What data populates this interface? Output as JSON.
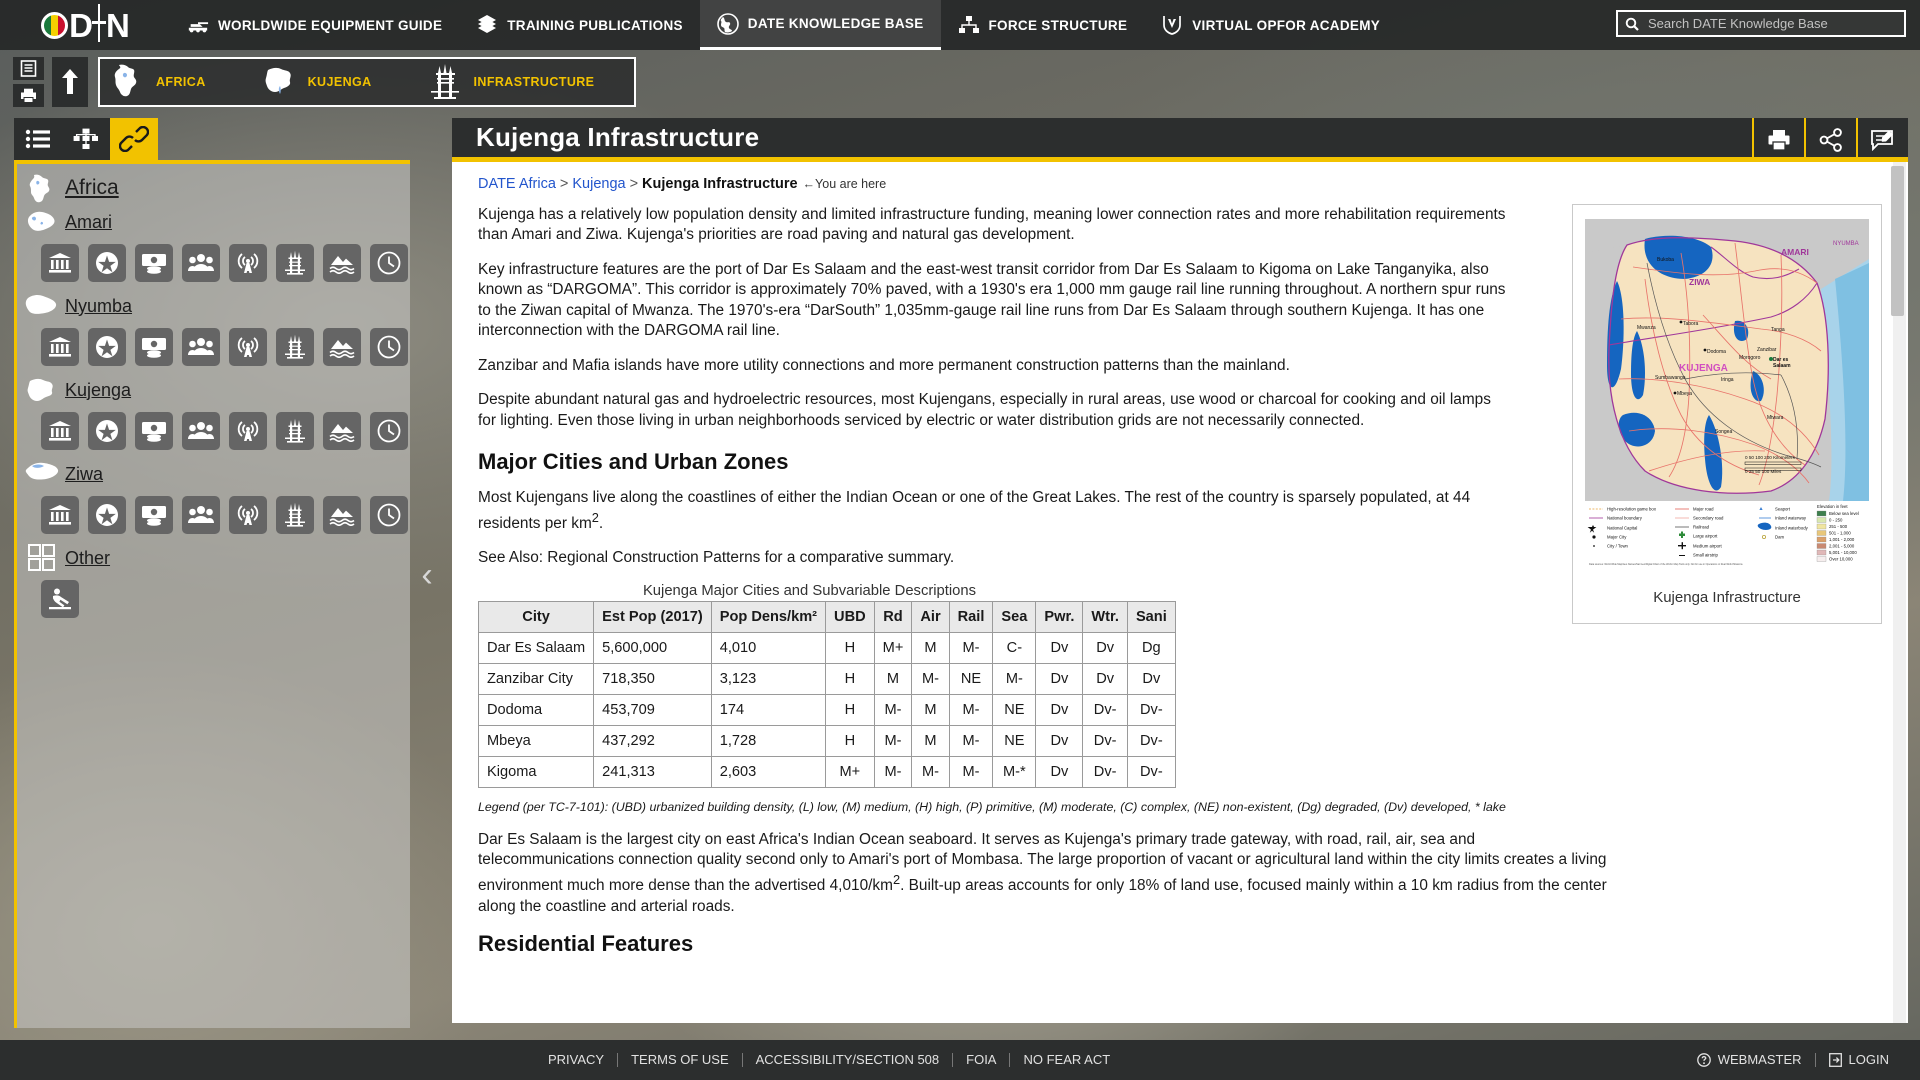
{
  "topnav": {
    "logo_text": "ODIN",
    "items": [
      {
        "label": "WORLDWIDE EQUIPMENT GUIDE",
        "icon": "tank-icon",
        "active": false
      },
      {
        "label": "TRAINING PUBLICATIONS",
        "icon": "books-icon",
        "active": false
      },
      {
        "label": "DATE KNOWLEDGE BASE",
        "icon": "globe-icon",
        "active": true
      },
      {
        "label": "FORCE STRUCTURE",
        "icon": "org-chart-icon",
        "active": false
      },
      {
        "label": "VIRTUAL OPFOR ACADEMY",
        "icon": "shield-v-icon",
        "active": false
      }
    ]
  },
  "search": {
    "placeholder": "Search DATE Knowledge Base",
    "value": ""
  },
  "crumbbar": {
    "doc_button": "document-icon",
    "print_button": "printer-icon",
    "up_button": "up-arrow-icon",
    "crumbs": [
      {
        "label": "AFRICA",
        "icon": "africa-map-icon"
      },
      {
        "label": "KUJENGA",
        "icon": "kujenga-map-icon"
      },
      {
        "label": "INFRASTRUCTURE",
        "icon": "infrastructure-icon"
      }
    ]
  },
  "leftpanel": {
    "tabs": [
      {
        "name": "list-view",
        "icon": "list-icon",
        "active": false
      },
      {
        "name": "tree-view",
        "icon": "org-tree-icon",
        "active": false
      },
      {
        "name": "links-view",
        "icon": "link-icon",
        "active": true
      }
    ],
    "variable_icons": [
      "political-icon",
      "military-icon",
      "economic-icon",
      "social-icon",
      "information-icon",
      "infrastructure-icon",
      "physical-environment-icon",
      "time-icon"
    ],
    "nodes": [
      {
        "label": "Africa",
        "icon": "africa-map-icon",
        "root": true,
        "has_variables": false
      },
      {
        "label": "Amari",
        "icon": "amari-map-icon",
        "root": false,
        "has_variables": true
      },
      {
        "label": "Nyumba",
        "icon": "nyumba-map-icon",
        "root": false,
        "has_variables": true
      },
      {
        "label": "Kujenga",
        "icon": "kujenga-map-icon",
        "root": false,
        "has_variables": true
      },
      {
        "label": "Ziwa",
        "icon": "ziwa-map-icon",
        "root": false,
        "has_variables": true
      },
      {
        "label": "Other",
        "icon": "grid-icon",
        "root": false,
        "has_variables": false
      }
    ],
    "other_icon": "threat-actor-icon",
    "collapse_arrow": "‹"
  },
  "main": {
    "title": "Kujenga Infrastructure",
    "actions": [
      {
        "name": "print-button",
        "icon": "printer-icon"
      },
      {
        "name": "share-button",
        "icon": "share-icon"
      },
      {
        "name": "feedback-button",
        "icon": "feedback-icon"
      }
    ],
    "breadcrumb": {
      "link1": "DATE Africa",
      "link2": "Kujenga",
      "current": "Kujenga Infrastructure",
      "you_are_here": "←You are here",
      "separator": ">"
    },
    "paragraphs": [
      "Kujenga has a relatively low population density and limited infrastructure funding, meaning lower connection rates and more rehabilitation requirements than Amari and Ziwa. Kujenga's priorities are road paving and natural gas development.",
      "Key infrastructure features are the port of Dar Es Salaam and the east-west transit corridor from Dar Es Salaam to Kigoma on Lake Tanganyika, also known as “DARGOMA”. This corridor is approximately 70% paved, with a 1930's era 1,000 mm gauge rail line running throughout. A northern spur runs to the Ziwan capital of Mwanza. The 1970's-era “DarSouth” 1,035mm-gauge rail line runs from Dar Es Salaam through southern Kujenga. It has one interconnection with the DARGOMA rail line.",
      "Zanzibar and Mafia islands have more utility connections and more permanent construction patterns than the mainland.",
      "Despite abundant natural gas and hydroelectric resources, most Kujengans, especially in rural areas, use wood or charcoal for cooking and oil lamps for lighting. Even those living in urban neighborhoods serviced by electric or water distribution grids are not necessarily connected."
    ],
    "section_heading": "Major Cities and Urban Zones",
    "para_density_pre": "Most Kujengans live along the coastlines of either the Indian Ocean or one of the Great Lakes. The rest of the country is sparsely populated, at 44 residents per km",
    "para_density_sup": "2",
    "para_density_post": ".",
    "see_also": "See Also: Regional Construction Patterns for a comparative summary.",
    "table_caption": "Kujenga Major Cities and Subvariable Descriptions",
    "legend_note": "Legend (per TC-7-101): (UBD) urbanized building density, (L) low, (M) medium, (H) high, (P) primitive, (M) moderate, (C) complex, (NE) non-existent, (Dg) degraded, (Dv) developed,  * lake",
    "final_para_pre": "Dar Es Salaam is the largest city on east Africa's Indian Ocean seaboard. It serves as Kujenga's primary trade gateway, with road, rail, air, sea and telecommunications connection quality second only to Amari's port of Mombasa. The large proportion of vacant or agricultural land within the city limits creates a living environment much more dense than the advertised 4,010/km",
    "final_para_sup": "2",
    "final_para_post": ". Built-up areas accounts for only 18% of land use, focused mainly within a 10 km radius from the center along the coastline and arterial roads.",
    "next_heading_partial": "Residential Features",
    "map_caption": "Kujenga Infrastructure"
  },
  "chart_data": {
    "type": "table",
    "title": "Kujenga Major Cities and Subvariable Descriptions",
    "columns": [
      "City",
      "Est Pop (2017)",
      "Pop Dens/km²",
      "UBD",
      "Rd",
      "Air",
      "Rail",
      "Sea",
      "Pwr.",
      "Wtr.",
      "Sani"
    ],
    "column_headers_plain": [
      "City",
      "Est Pop (2017)",
      "Pop Dens/km2",
      "UBD",
      "Rd",
      "Air",
      "Rail",
      "Sea",
      "Pwr.",
      "Wtr.",
      "Sani"
    ],
    "rows": [
      {
        "city": "Dar Es Salaam",
        "pop": "5,600,000",
        "dens": "4,010",
        "ubd": "H",
        "rd": "M+",
        "air": "M",
        "rail": "M-",
        "sea": "C-",
        "pwr": "Dv",
        "wtr": "Dv",
        "sani": "Dg"
      },
      {
        "city": "Zanzibar City",
        "pop": "718,350",
        "dens": "3,123",
        "ubd": "H",
        "rd": "M",
        "air": "M-",
        "rail": "NE",
        "sea": "M-",
        "pwr": "Dv",
        "wtr": "Dv",
        "sani": "Dv"
      },
      {
        "city": "Dodoma",
        "pop": "453,709",
        "dens": "174",
        "ubd": "H",
        "rd": "M-",
        "air": "M",
        "rail": "M-",
        "sea": "NE",
        "pwr": "Dv",
        "wtr": "Dv-",
        "sani": "Dv-"
      },
      {
        "city": "Mbeya",
        "pop": "437,292",
        "dens": "1,728",
        "ubd": "H",
        "rd": "M-",
        "air": "M",
        "rail": "M-",
        "sea": "NE",
        "pwr": "Dv",
        "wtr": "Dv-",
        "sani": "Dv-"
      },
      {
        "city": "Kigoma",
        "pop": "241,313",
        "dens": "2,603",
        "ubd": "M+",
        "rd": "M-",
        "air": "M-",
        "rail": "M-",
        "sea": "M-*",
        "pwr": "Dv",
        "wtr": "Dv-",
        "sani": "Dv-"
      }
    ]
  },
  "map_thumb": {
    "country_label": "KUJENGA",
    "neighbor_labels": [
      "AMARI",
      "ZIWA",
      "NYUMBA"
    ],
    "cities": [
      "Bukoba",
      "Mwanza",
      "Tabora",
      "Dodoma",
      "Tanga",
      "Zanzibar",
      "Dar es Salaam",
      "Morogoro",
      "Iringa",
      "Mbeya",
      "Songea",
      "Mtwara",
      "Sumbawanga"
    ],
    "legend_left": [
      "High-resolution game box",
      "National boundary",
      "National Capital",
      "Major City",
      "City / Town"
    ],
    "legend_mid": [
      "Major road",
      "Secondary road",
      "Railroad",
      "Large airport",
      "Medium airport",
      "Small airstrip"
    ],
    "legend_right": [
      "Seaport",
      "Inland waterway",
      "Inland waterbody",
      "Dam"
    ],
    "elev_title": "Elevation in feet",
    "elev_classes": [
      "Below sea level",
      "0 - 250",
      "251 - 500",
      "501 - 1,000",
      "1,001 - 2,000",
      "2,001 - 5,000",
      "5,001 - 10,000",
      "Over 10,000"
    ],
    "scale_km": "0   50  100        200 Kilometers",
    "scale_mi": "0   25  50         100 Miles"
  },
  "footer": {
    "links": [
      "PRIVACY",
      "TERMS OF USE",
      "ACCESSIBILITY/SECTION 508",
      "FOIA",
      "NO FEAR ACT"
    ],
    "webmaster": "WEBMASTER",
    "login": "LOGIN"
  },
  "colors": {
    "accent_yellow": "#f2c200",
    "dark_bar": "#2c2e2e",
    "link_blue": "#2255cc",
    "panel_grey": "#c8c8c6"
  }
}
